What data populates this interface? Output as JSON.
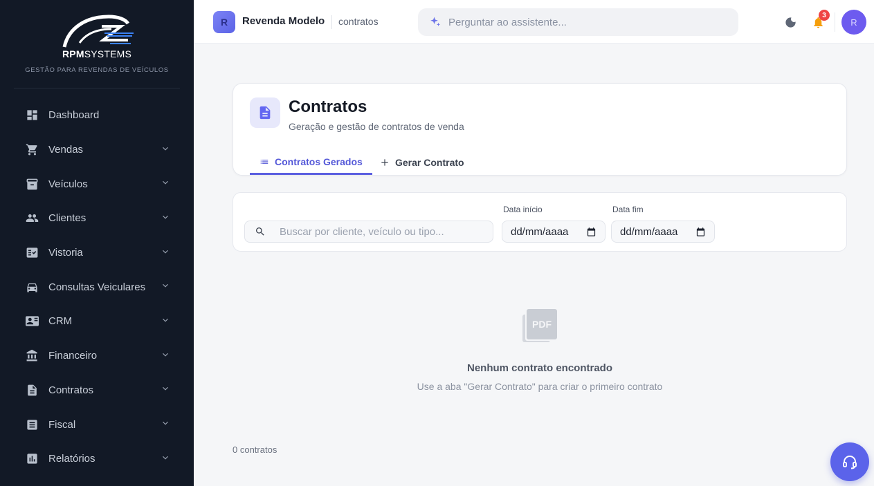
{
  "brand": {
    "name_bold": "RPM",
    "name_rest": "SYSTEMS",
    "tagline": "GESTÃO PARA REVENDAS DE VEÍCULOS"
  },
  "sidebar": {
    "items": [
      {
        "label": "Dashboard",
        "icon": "dashboard-icon",
        "has_submenu": false
      },
      {
        "label": "Vendas",
        "icon": "cart-icon",
        "has_submenu": true
      },
      {
        "label": "Veículos",
        "icon": "archive-icon",
        "has_submenu": true
      },
      {
        "label": "Clientes",
        "icon": "people-icon",
        "has_submenu": true
      },
      {
        "label": "Vistoria",
        "icon": "checklist-icon",
        "has_submenu": true
      },
      {
        "label": "Consultas Veiculares",
        "icon": "car-icon",
        "has_submenu": true
      },
      {
        "label": "CRM",
        "icon": "contact-card-icon",
        "has_submenu": true
      },
      {
        "label": "Financeiro",
        "icon": "bank-icon",
        "has_submenu": true
      },
      {
        "label": "Contratos",
        "icon": "document-icon",
        "has_submenu": true
      },
      {
        "label": "Fiscal",
        "icon": "receipt-icon",
        "has_submenu": true
      },
      {
        "label": "Relatórios",
        "icon": "bar-chart-icon",
        "has_submenu": true
      }
    ]
  },
  "header": {
    "store_initial": "R",
    "store_name": "Revenda Modelo",
    "breadcrumb": "contratos",
    "assistant_placeholder": "Perguntar ao assistente...",
    "notification_count": "3",
    "user_initial": "R"
  },
  "page": {
    "title": "Contratos",
    "subtitle": "Geração e gestão de contratos de venda",
    "tabs": [
      {
        "label": "Contratos Gerados",
        "active": true
      },
      {
        "label": "Gerar Contrato",
        "active": false
      }
    ]
  },
  "filters": {
    "search_placeholder": "Buscar por cliente, veículo ou tipo...",
    "start_label": "Data início",
    "start_value": "dd/mm/aaaa",
    "end_label": "Data fim",
    "end_value": "dd/mm/aaaa"
  },
  "empty": {
    "title": "Nenhum contrato encontrado",
    "subtitle": "Use a aba \"Gerar Contrato\" para criar o primeiro contrato"
  },
  "footer": {
    "count": "0 contratos"
  },
  "colors": {
    "sidebar_bg": "#121926",
    "accent": "#5b63ea",
    "badge": "#ef4444"
  }
}
